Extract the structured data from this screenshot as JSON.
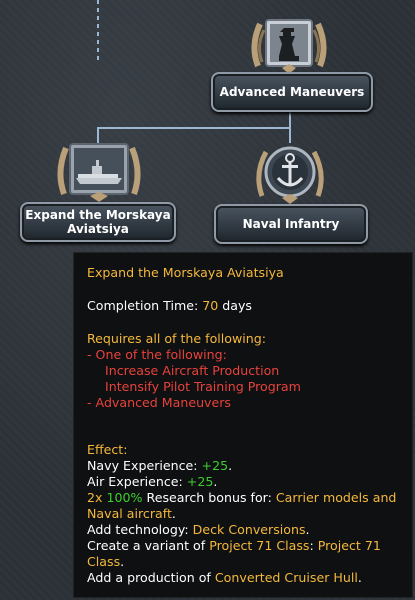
{
  "tree": {
    "nodes": [
      {
        "label": "Advanced Maneuvers",
        "icon": "chess-king-icon"
      },
      {
        "label_line1": "Expand the Morskaya",
        "label_line2": "Aviatsiya",
        "icon": "aircraft-carrier-icon"
      },
      {
        "label": "Naval Infantry",
        "icon": "anchor-icon"
      }
    ],
    "colors": {
      "connector": "#9cb7cf",
      "node_border": "#8f9aa6"
    }
  },
  "tooltip": {
    "title": "Expand the Morskaya Aviatsiya",
    "completion_label": "Completion Time:",
    "completion_value": "70",
    "completion_unit": "days",
    "requires_header": "Requires all of the following:",
    "requires_one_of": "- One of the following:",
    "requires_opt1": "Increase Aircraft Production",
    "requires_opt2": "Intensify Pilot Training Program",
    "requires_adv": "- Advanced Maneuvers",
    "effect_header": "Effect:",
    "navy_xp_label": "Navy Experience:",
    "navy_xp_value": "+25",
    "air_xp_label": "Air Experience:",
    "air_xp_value": "+25",
    "research_count": "2x",
    "research_pct": "100%",
    "research_text": "Research bonus for:",
    "research_target_1": "Carrier models and",
    "research_target_2": "Naval aircraft",
    "add_tech_label": "Add technology:",
    "add_tech_value": "Deck Conversions",
    "variant_label": "Create a variant of",
    "variant_base": "Project 71 Class",
    "variant_name_1": "Project 71",
    "variant_name_2": "Class",
    "production_label": "Add a production of",
    "production_value": "Converted Cruiser Hull",
    "colors": {
      "title": "#f5b83d",
      "requirement": "#e8423c",
      "positive": "#3dcf2e",
      "highlight": "#f5b83d"
    }
  }
}
